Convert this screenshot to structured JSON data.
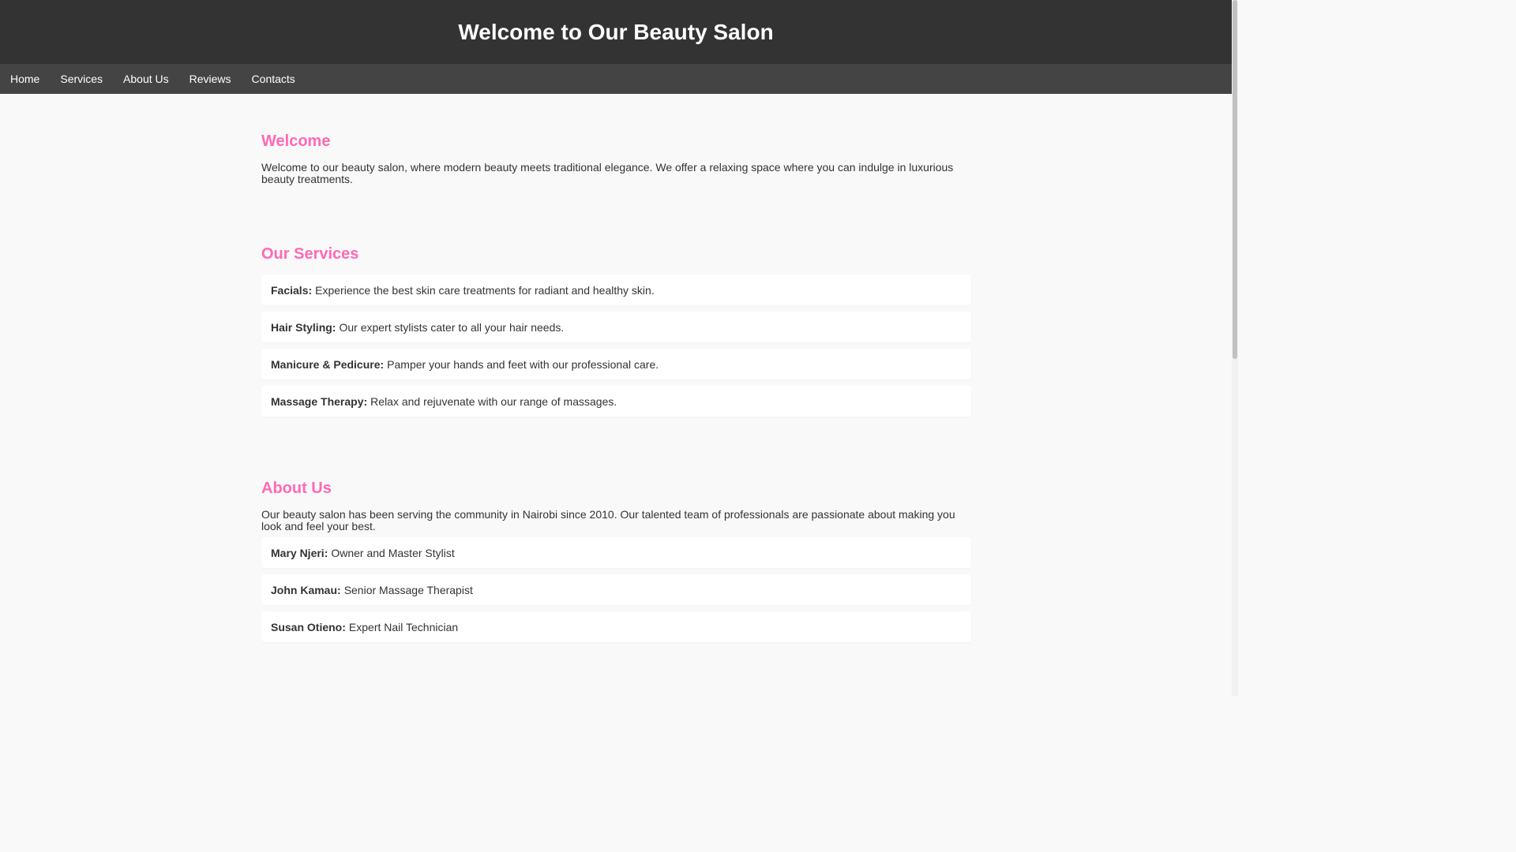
{
  "header": {
    "title": "Welcome to Our Beauty Salon"
  },
  "nav": {
    "items": [
      {
        "label": "Home"
      },
      {
        "label": "Services"
      },
      {
        "label": "About Us"
      },
      {
        "label": "Reviews"
      },
      {
        "label": "Contacts"
      }
    ]
  },
  "welcome": {
    "heading": "Welcome",
    "text": "Welcome to our beauty salon, where modern beauty meets traditional elegance. We offer a relaxing space where you can indulge in luxurious beauty treatments."
  },
  "services": {
    "heading": "Our Services",
    "items": [
      {
        "name": "Facials:",
        "description": "Experience the best skin care treatments for radiant and healthy skin."
      },
      {
        "name": "Hair Styling:",
        "description": "Our expert stylists cater to all your hair needs."
      },
      {
        "name": "Manicure & Pedicure:",
        "description": "Pamper your hands and feet with our professional care."
      },
      {
        "name": "Massage Therapy:",
        "description": "Relax and rejuvenate with our range of massages."
      }
    ]
  },
  "about": {
    "heading": "About Us",
    "text": "Our beauty salon has been serving the community in Nairobi since 2010. Our talented team of professionals are passionate about making you look and feel your best.",
    "team": [
      {
        "name": "Mary Njeri:",
        "role": "Owner and Master Stylist"
      },
      {
        "name": "John Kamau:",
        "role": "Senior Massage Therapist"
      },
      {
        "name": "Susan Otieno:",
        "role": "Expert Nail Technician"
      }
    ]
  },
  "colors": {
    "header_bg": "#333333",
    "nav_bg": "#444444",
    "accent": "#ff69b4",
    "page_bg": "#f9f9f9",
    "card_bg": "#ffffff"
  }
}
